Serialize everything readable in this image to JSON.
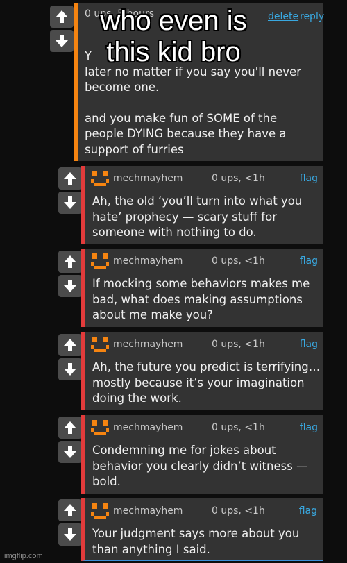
{
  "meme_caption": [
    "who even is",
    "this kid bro"
  ],
  "top_comment": {
    "meta": "0 ups, 5 hours",
    "delete_label": "delete",
    "reply_label": "reply",
    "text_line1": "Y",
    "text_line2_partial": "later no matter if you say you'll never",
    "text_line3": "become one.",
    "text_para2": [
      "and you make fun of SOME of the",
      "people DYING because they have a",
      "support of furries"
    ]
  },
  "replies": [
    {
      "user": "mechmayhem",
      "meta": "0 ups, <1h",
      "flag": "flag",
      "lines": [
        "Ah, the old ‘you’ll turn into what you",
        "hate’ prophecy — scary stuff for",
        "someone with nothing to do."
      ]
    },
    {
      "user": "mechmayhem",
      "meta": "0 ups, <1h",
      "flag": "flag",
      "lines": [
        "If mocking some behaviors makes me",
        "bad, what does making assumptions",
        "about me make you?"
      ]
    },
    {
      "user": "mechmayhem",
      "meta": "0 ups, <1h",
      "flag": "flag",
      "lines": [
        "Ah, the future you predict is terrifying…",
        "mostly because it’s your imagination",
        "doing the work."
      ]
    },
    {
      "user": "mechmayhem",
      "meta": "0 ups, <1h",
      "flag": "flag",
      "lines": [
        "Condemning me for jokes about",
        "behavior you clearly didn’t witness —",
        "bold."
      ]
    },
    {
      "user": "mechmayhem",
      "meta": "0 ups, <1h",
      "flag": "flag",
      "lines": [
        "Your judgment says more about you",
        "than anything I said."
      ]
    }
  ],
  "watermark": "imgflip.com",
  "colors": {
    "accent_red": "#e23b3b",
    "accent_orange": "#f58411",
    "link_blue": "#39a8e0",
    "avatar_orange": "#f58411"
  },
  "icons": {
    "upvote": "arrow-up-icon",
    "downvote": "arrow-down-icon",
    "avatar": "pixel-smiley-icon"
  }
}
